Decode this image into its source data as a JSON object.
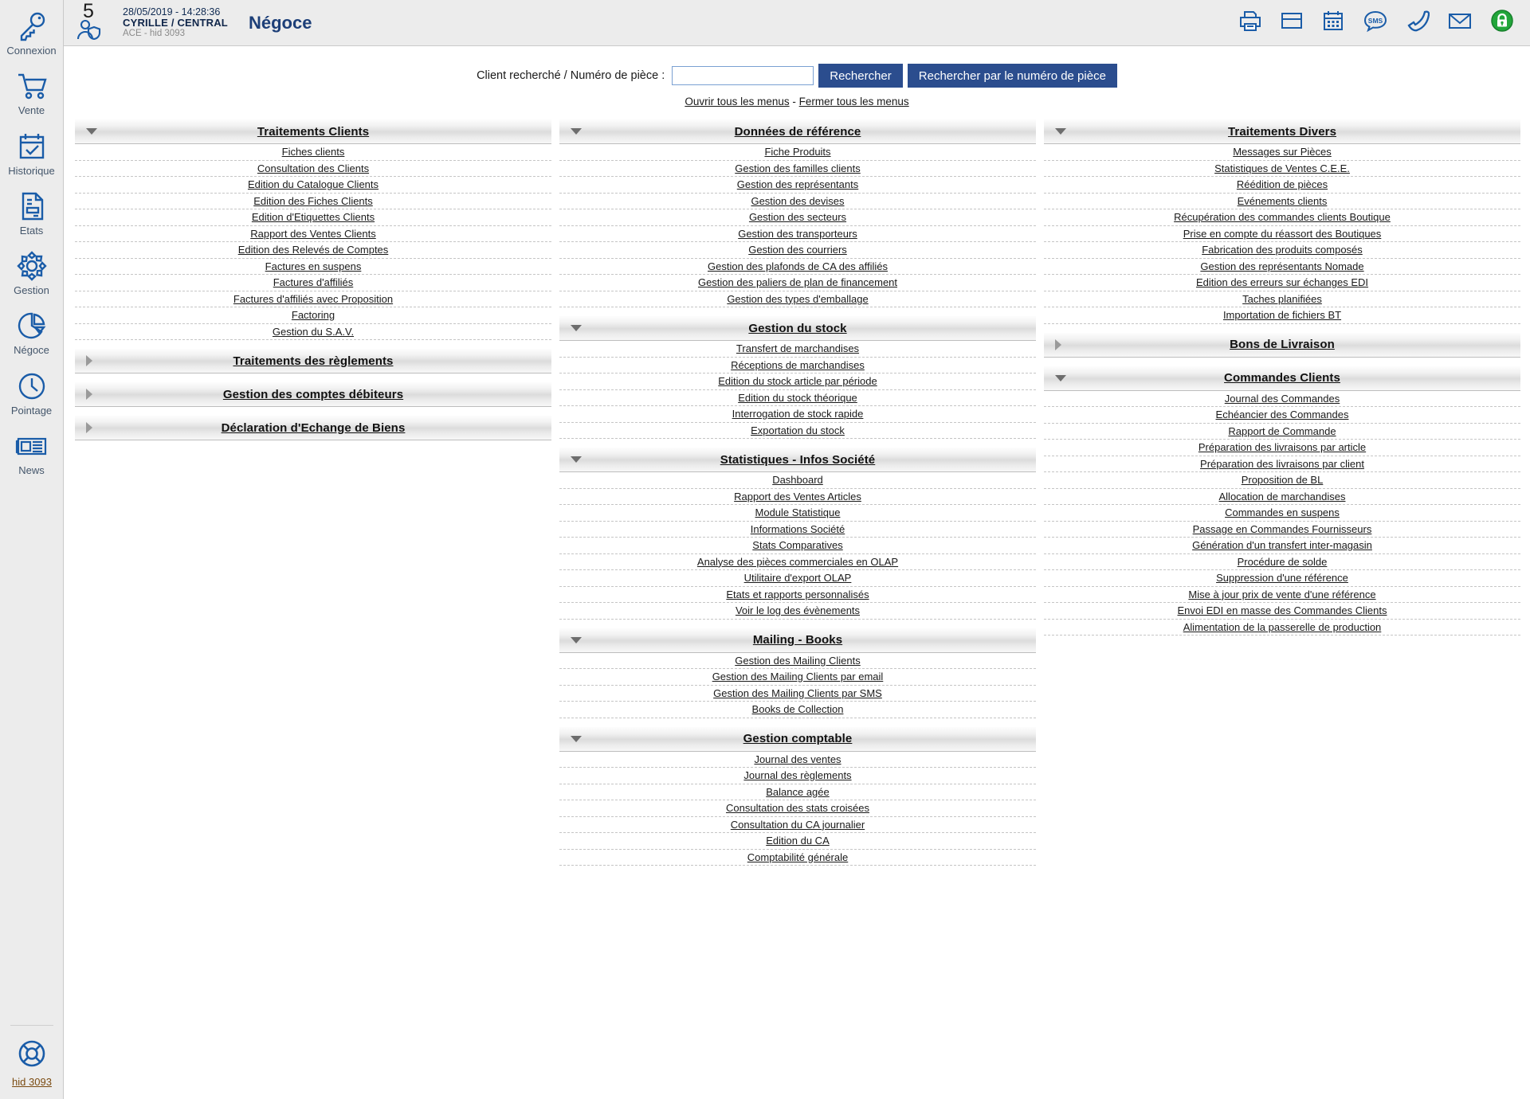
{
  "header": {
    "badge_count": "5",
    "badge_icon": "user-shield-icon",
    "datetime": "28/05/2019 - 14:28:36",
    "user": "CYRILLE / CENTRAL",
    "subinfo": "ACE - hid 3093",
    "app_title": "Négoce",
    "icons": [
      {
        "name": "printer-icon"
      },
      {
        "name": "window-icon"
      },
      {
        "name": "calendar-icon"
      },
      {
        "name": "sms-icon"
      },
      {
        "name": "phone-icon"
      },
      {
        "name": "envelope-icon"
      },
      {
        "name": "lock-icon"
      }
    ]
  },
  "sidebar": {
    "items": [
      {
        "label": "Connexion",
        "icon": "key-icon"
      },
      {
        "label": "Vente",
        "icon": "shopping-cart-icon"
      },
      {
        "label": "Historique",
        "icon": "calendar-check-icon"
      },
      {
        "label": "Etats",
        "icon": "document-icon"
      },
      {
        "label": "Gestion",
        "icon": "gear-icon"
      },
      {
        "label": "Négoce",
        "icon": "pie-chart-icon"
      },
      {
        "label": "Pointage",
        "icon": "clock-icon"
      },
      {
        "label": "News",
        "icon": "newspaper-icon"
      }
    ],
    "support": {
      "label": "hid 3093",
      "icon": "life-ring-icon"
    }
  },
  "search": {
    "label": "Client recherché / Numéro de pièce :",
    "value": "",
    "placeholder": "",
    "button_search": "Rechercher",
    "button_search_by_number": "Rechercher par le numéro de pièce",
    "open_all": "Ouvrir tous les menus",
    "separator": "-",
    "close_all": "Fermer tous les menus"
  },
  "colors": {
    "accent": "#2b4d8e",
    "sidebar_icon": "#1a5ca8",
    "sidebar_bg": "#ececec",
    "lock_green": "#22a63a",
    "link": "#1a1a1a"
  },
  "columns": [
    {
      "panels": [
        {
          "title": "Traitements Clients",
          "expanded": true,
          "items": [
            "Fiches clients",
            "Consultation des Clients",
            "Edition du Catalogue Clients",
            "Edition des Fiches Clients",
            "Edition d'Etiquettes Clients",
            "Rapport des Ventes Clients",
            "Edition des Relevés de Comptes",
            "Factures en suspens",
            "Factures d'affiliés",
            "Factures d'affiliés avec Proposition",
            "Factoring",
            "Gestion du S.A.V."
          ]
        },
        {
          "title": "Traitements des règlements",
          "expanded": false,
          "items": []
        },
        {
          "title": "Gestion des comptes débiteurs",
          "expanded": false,
          "items": []
        },
        {
          "title": "Déclaration d'Echange de Biens",
          "expanded": false,
          "items": []
        }
      ]
    },
    {
      "panels": [
        {
          "title": "Données de référence",
          "expanded": true,
          "items": [
            "Fiche Produits",
            "Gestion des familles clients",
            "Gestion des représentants",
            "Gestion des devises",
            "Gestion des secteurs",
            "Gestion des transporteurs",
            "Gestion des courriers",
            "Gestion des plafonds de CA des affiliés",
            "Gestion des paliers de plan de financement",
            "Gestion des types d'emballage"
          ]
        },
        {
          "title": "Gestion du stock",
          "expanded": true,
          "items": [
            "Transfert de marchandises",
            "Réceptions de marchandises",
            "Edition du stock article par période",
            "Edition du stock théorique",
            "Interrogation de stock rapide",
            "Exportation du stock"
          ]
        },
        {
          "title": "Statistiques - Infos Société",
          "expanded": true,
          "items": [
            "Dashboard",
            "Rapport des Ventes Articles",
            "Module Statistique",
            "Informations Société",
            "Stats Comparatives",
            "Analyse des pièces commerciales en OLAP",
            "Utilitaire d'export OLAP",
            "Etats et rapports personnalisés",
            "Voir le log des évènements"
          ]
        },
        {
          "title": "Mailing - Books",
          "expanded": true,
          "items": [
            "Gestion des Mailing Clients",
            "Gestion des Mailing Clients par email",
            "Gestion des Mailing Clients par SMS",
            "Books de Collection"
          ]
        },
        {
          "title": "Gestion comptable",
          "expanded": true,
          "items": [
            "Journal des ventes",
            "Journal des règlements",
            "Balance agée",
            "Consultation des stats croisées",
            "Consultation du CA journalier",
            "Edition du CA",
            "Comptabilité générale"
          ]
        }
      ]
    },
    {
      "panels": [
        {
          "title": "Traitements Divers",
          "expanded": true,
          "items": [
            "Messages sur Pièces",
            "Statistiques de Ventes C.E.E.",
            "Réédition de pièces",
            "Evénements clients",
            "Récupération des commandes clients Boutique",
            "Prise en compte du réassort des Boutiques",
            "Fabrication des produits composés",
            "Gestion des représentants Nomade",
            "Edition des erreurs sur échanges EDI",
            "Taches planifiées",
            "Importation de fichiers BT"
          ]
        },
        {
          "title": "Bons de Livraison",
          "expanded": false,
          "items": []
        },
        {
          "title": "Commandes Clients",
          "expanded": true,
          "items": [
            "Journal des Commandes",
            "Echéancier des Commandes",
            "Rapport de Commande",
            "Préparation des livraisons par article",
            "Préparation des livraisons par client",
            "Proposition de BL",
            "Allocation de marchandises",
            "Commandes en suspens",
            "Passage en Commandes Fournisseurs",
            "Génération d'un transfert inter-magasin",
            "Procédure de solde",
            "Suppression d'une référence",
            "Mise à jour prix de vente d'une référence",
            "Envoi EDI en masse des Commandes Clients",
            "Alimentation de la passerelle de production"
          ]
        }
      ]
    }
  ]
}
